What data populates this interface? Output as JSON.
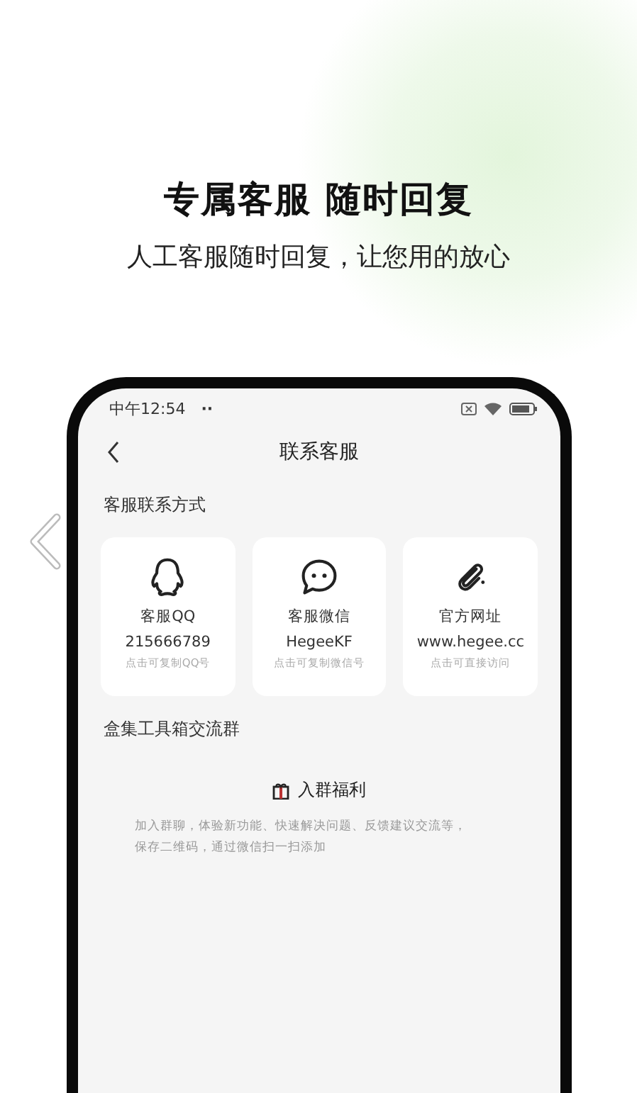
{
  "headline": "专属客服 随时回复",
  "subheadline": "人工客服随时回复，让您用的放心",
  "phone": {
    "status_bar": {
      "time": "中午12:54",
      "dots": "··"
    },
    "nav_title": "联系客服",
    "section_title": "客服联系方式",
    "contacts": [
      {
        "kind": "qq",
        "label": "客服QQ",
        "value": "215666789",
        "hint": "点击可复制QQ号"
      },
      {
        "kind": "chat",
        "label": "客服微信",
        "value": "HegeeKF",
        "hint": "点击可复制微信号"
      },
      {
        "kind": "link",
        "label": "官方网址",
        "value": "www.hegee.cc",
        "hint": "点击可直接访问"
      }
    ],
    "group": {
      "title": "盒集工具箱交流群",
      "benefit_title": "入群福利",
      "description": "加入群聊，体验新功能、快速解决问题、反馈建议交流等，保存二维码，通过微信扫一扫添加"
    }
  }
}
